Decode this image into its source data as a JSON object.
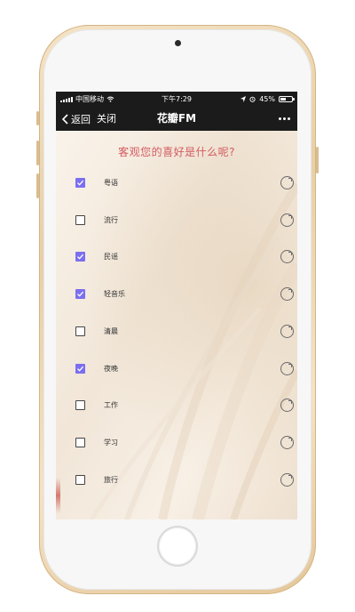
{
  "status_bar": {
    "carrier": "中国移动",
    "time": "下午7:29",
    "battery": "45%"
  },
  "nav": {
    "back_label": "返回",
    "close_label": "关闭",
    "title": "花瓣FM"
  },
  "question": "客观您的喜好是什么呢?",
  "preferences": [
    {
      "label": "粤语",
      "checked": true
    },
    {
      "label": "流行",
      "checked": false
    },
    {
      "label": "民谣",
      "checked": true
    },
    {
      "label": "轻音乐",
      "checked": true
    },
    {
      "label": "清晨",
      "checked": false
    },
    {
      "label": "夜晚",
      "checked": true
    },
    {
      "label": "工作",
      "checked": false
    },
    {
      "label": "学习",
      "checked": false
    },
    {
      "label": "旅行",
      "checked": false
    }
  ],
  "colors": {
    "question": "#d35a5f",
    "checkbox_checked": "#7b6ff0",
    "phone_frame": "#e8cfa6"
  }
}
